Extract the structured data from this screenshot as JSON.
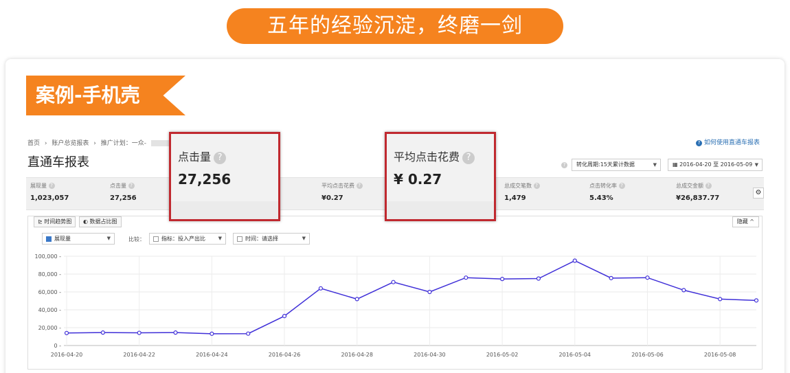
{
  "banner": {
    "text": "五年的经验沉淀，终磨一剑"
  },
  "case_tag": {
    "text": "案例-手机壳"
  },
  "report": {
    "breadcrumb": {
      "home": "首页",
      "sep": "›",
      "account": "账户总览报表",
      "plan": "推广计划：一众-"
    },
    "help_link": "如何使用直通车报表",
    "title": "直通车报表",
    "period_select": "转化周期:15天累计数据",
    "date_range": "2016-04-20 至 2016-05-09",
    "stats": [
      {
        "label": "展现量",
        "value": "1,023,057"
      },
      {
        "label": "点击量",
        "value": "27,256"
      },
      {
        "label": "平均点击花费",
        "value": "¥0.27"
      },
      {
        "label": "总成交笔数",
        "value": "1,479"
      },
      {
        "label": "点击转化率",
        "value": "5.43%"
      },
      {
        "label": "总成交金额",
        "value": "¥26,837.77"
      }
    ],
    "tabs": {
      "trend": "时间趋势图",
      "ratio": "数据占比图",
      "collapse": "隐藏 ^"
    },
    "controls": {
      "metric": "展现量",
      "compare_label": "比较：",
      "indicator": "指标：投入产出比",
      "time": "时间：请选择"
    }
  },
  "highlights": [
    {
      "label": "点击量",
      "value": "27,256"
    },
    {
      "label": "平均点击花费",
      "value": "¥ 0.27"
    }
  ],
  "chart_data": {
    "type": "line",
    "x": [
      "2016-04-20",
      "2016-04-21",
      "2016-04-22",
      "2016-04-23",
      "2016-04-24",
      "2016-04-25",
      "2016-04-26",
      "2016-04-27",
      "2016-04-28",
      "2016-04-29",
      "2016-04-30",
      "2016-05-01",
      "2016-05-02",
      "2016-05-03",
      "2016-05-04",
      "2016-05-05",
      "2016-05-06",
      "2016-05-07",
      "2016-05-08",
      "2016-05-09"
    ],
    "xticks": [
      "2016-04-20",
      "2016-04-22",
      "2016-04-24",
      "2016-04-26",
      "2016-04-28",
      "2016-04-30",
      "2016-05-02",
      "2016-05-04",
      "2016-05-06",
      "2016-05-08"
    ],
    "series": [
      {
        "name": "展现量",
        "color": "#3f2fd8",
        "values": [
          14000,
          14500,
          14200,
          14500,
          13200,
          13300,
          33000,
          64000,
          52000,
          71000,
          60000,
          76000,
          74500,
          75000,
          95000,
          75500,
          76000,
          62000,
          52000,
          50500
        ]
      }
    ],
    "yticks": [
      "100,000",
      "80,000",
      "60,000",
      "40,000",
      "20,000",
      "0"
    ],
    "ylim": [
      0,
      100000
    ],
    "grid": true
  }
}
